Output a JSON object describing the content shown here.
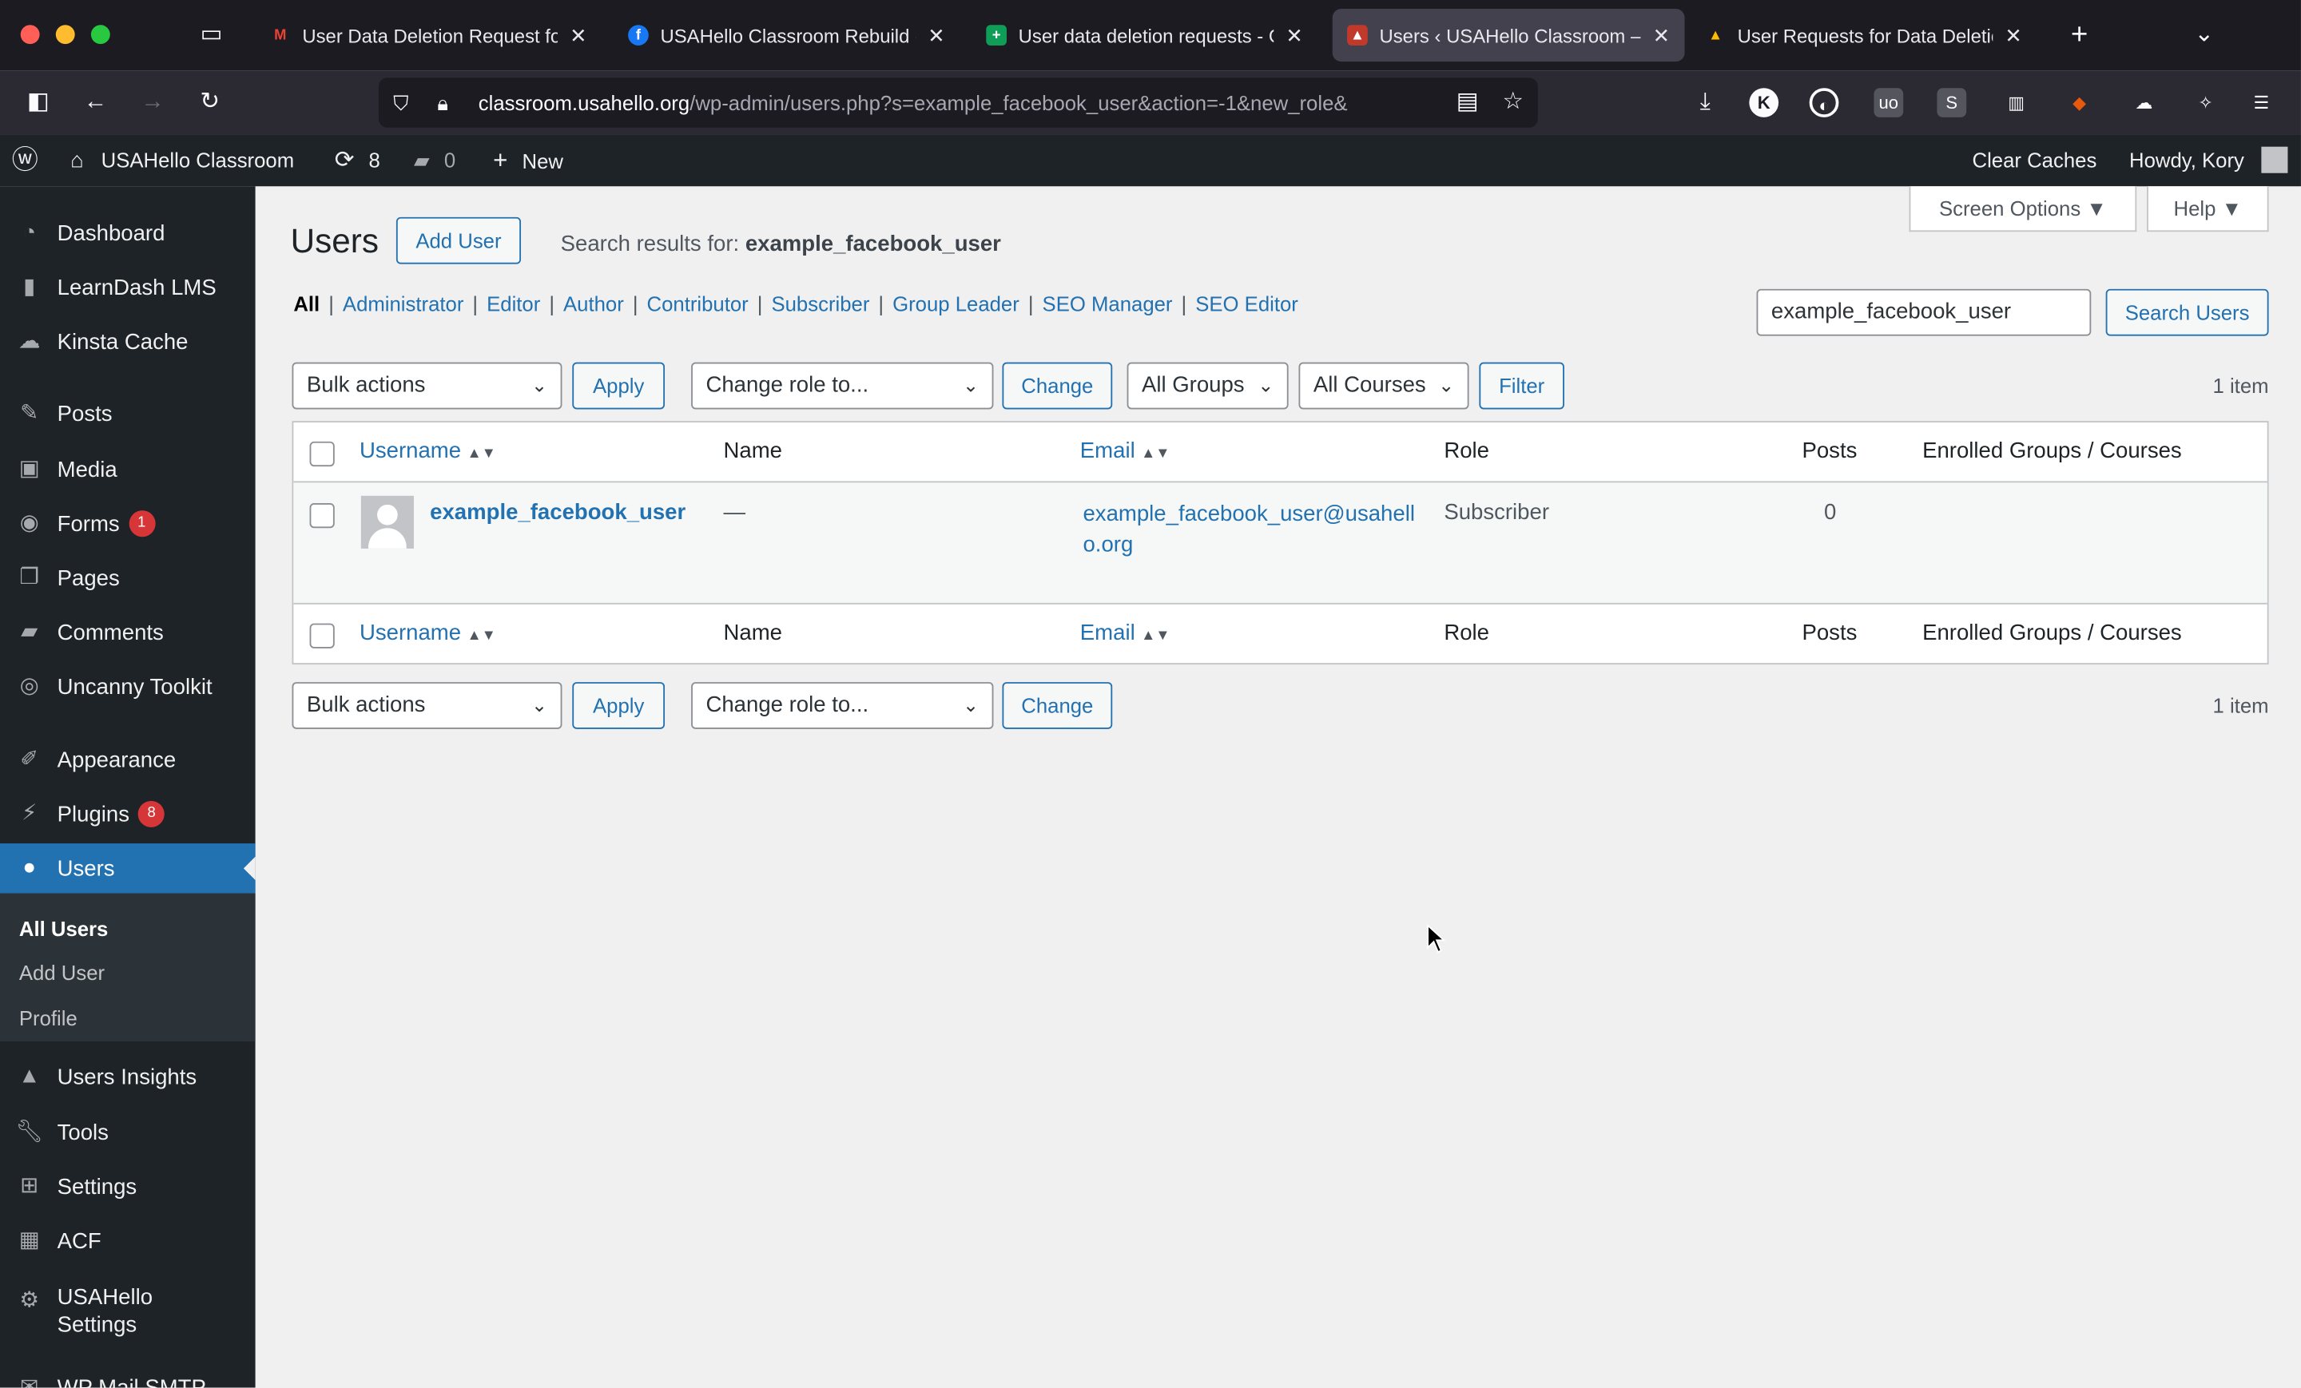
{
  "browser": {
    "tabs": [
      {
        "label": "User Data Deletion Request for (",
        "favicon": "gmail-icon",
        "color": "#ea4335",
        "active": false
      },
      {
        "label": "USAHello Classroom Rebuild - A",
        "favicon": "facebook-icon",
        "color": "#1877f2",
        "active": false
      },
      {
        "label": "User data deletion requests - Go",
        "favicon": "sheets-icon",
        "color": "#0f9d58",
        "active": false
      },
      {
        "label": "Users ‹ USAHello Classroom — V",
        "favicon": "usahello-icon",
        "color": "#c0392b",
        "active": true
      },
      {
        "label": "User Requests for Data Deletion",
        "favicon": "drive-icon",
        "color": "#fbbc04",
        "active": false
      }
    ],
    "url_host": "classroom.usahello.org",
    "url_path": "/wp-admin/users.php?s=example_facebook_user&action=-1&new_role&"
  },
  "adminbar": {
    "site_name": "USAHello Classroom",
    "updates_count": "8",
    "comments_count": "0",
    "new_label": "New",
    "clear_caches": "Clear Caches",
    "howdy": "Howdy, Kory"
  },
  "sidebar": {
    "items": [
      {
        "label": "Dashboard",
        "icon": "dashboard-icon"
      },
      {
        "label": "LearnDash LMS",
        "icon": "chart-icon"
      },
      {
        "label": "Kinsta Cache",
        "icon": "cloud-icon"
      },
      {
        "label": "Posts",
        "icon": "pin-icon"
      },
      {
        "label": "Media",
        "icon": "media-icon"
      },
      {
        "label": "Forms",
        "icon": "forms-icon",
        "badge": "1"
      },
      {
        "label": "Pages",
        "icon": "pages-icon"
      },
      {
        "label": "Comments",
        "icon": "comment-icon"
      },
      {
        "label": "Uncanny Toolkit",
        "icon": "toolkit-icon"
      },
      {
        "label": "Appearance",
        "icon": "brush-icon"
      },
      {
        "label": "Plugins",
        "icon": "plugin-icon",
        "badge": "8"
      },
      {
        "label": "Users",
        "icon": "user-icon",
        "current": true
      },
      {
        "label": "Users Insights",
        "icon": "insights-icon"
      },
      {
        "label": "Tools",
        "icon": "wrench-icon"
      },
      {
        "label": "Settings",
        "icon": "settings-icon"
      },
      {
        "label": "ACF",
        "icon": "acf-icon"
      },
      {
        "label": "USAHello Settings",
        "icon": "gear-icon"
      },
      {
        "label": "WP Mail SMTP",
        "icon": "mail-icon"
      }
    ],
    "submenu": [
      "All Users",
      "Add User",
      "Profile"
    ]
  },
  "page": {
    "title": "Users",
    "add_user": "Add User",
    "search_prefix": "Search results for: ",
    "search_term": "example_facebook_user",
    "screen_options": "Screen Options",
    "help": "Help",
    "filters": [
      "All",
      "Administrator",
      "Editor",
      "Author",
      "Contributor",
      "Subscriber",
      "Group Leader",
      "SEO Manager",
      "SEO Editor"
    ],
    "search_input": "example_facebook_user",
    "search_button": "Search Users",
    "bulk_actions": "Bulk actions",
    "apply": "Apply",
    "change_role": "Change role to...",
    "change": "Change",
    "all_groups": "All Groups",
    "all_courses": "All Courses",
    "filter": "Filter",
    "item_count": "1 item"
  },
  "table": {
    "headers": {
      "username": "Username",
      "name": "Name",
      "email": "Email",
      "role": "Role",
      "posts": "Posts",
      "enrolled": "Enrolled Groups / Courses"
    },
    "rows": [
      {
        "username": "example_facebook_user",
        "name": "—",
        "email_line1": "example_facebook_user@usahell",
        "email_line2": "o.org",
        "role": "Subscriber",
        "posts": "0"
      }
    ]
  }
}
